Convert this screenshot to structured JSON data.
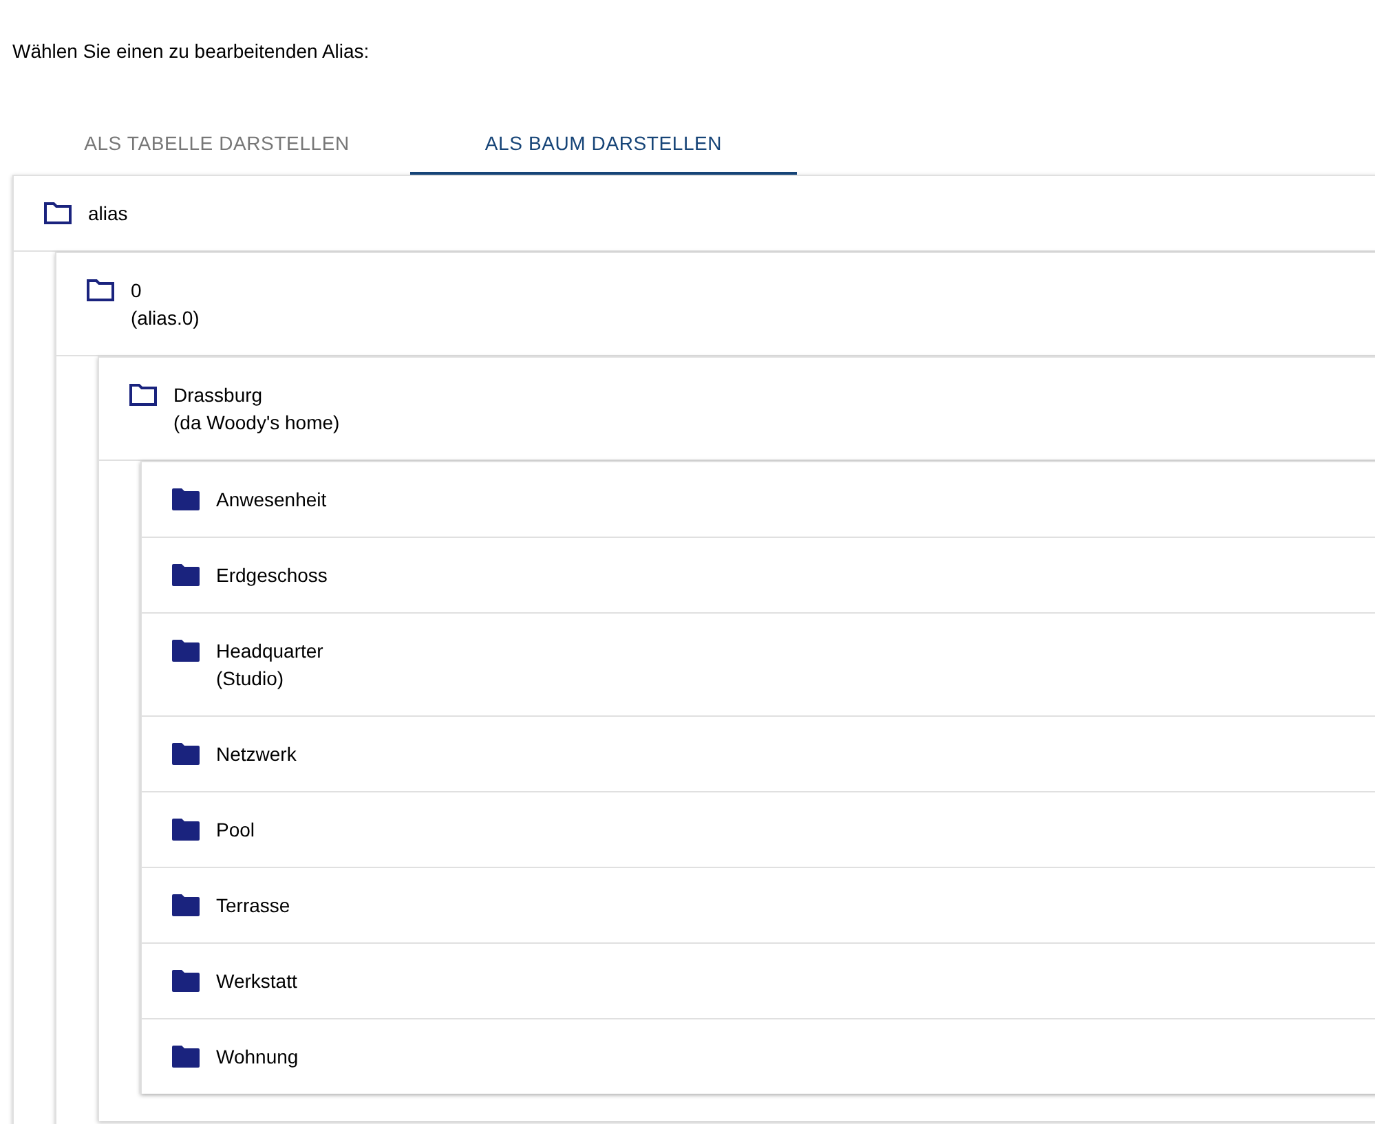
{
  "heading": "Wählen Sie einen zu bearbeitenden Alias:",
  "tabs": [
    {
      "label": "ALS TABELLE DARSTELLEN",
      "selected": false
    },
    {
      "label": "ALS BAUM DARSTELLEN",
      "selected": true
    }
  ],
  "tree": [
    {
      "name": "alias",
      "expanded": true,
      "children": [
        {
          "name": "0",
          "subtitle": "(alias.0)",
          "expanded": true,
          "children": [
            {
              "name": "Drassburg",
              "subtitle": "(da Woody's home)",
              "expanded": true,
              "children": [
                {
                  "name": "Anwesenheit",
                  "expanded": false
                },
                {
                  "name": "Erdgeschoss",
                  "expanded": false
                },
                {
                  "name": "Headquarter",
                  "subtitle": "(Studio)",
                  "expanded": false
                },
                {
                  "name": "Netzwerk",
                  "expanded": false
                },
                {
                  "name": "Pool",
                  "expanded": false
                },
                {
                  "name": "Terrasse",
                  "expanded": false
                },
                {
                  "name": "Werkstatt",
                  "expanded": false
                },
                {
                  "name": "Wohnung",
                  "expanded": false
                }
              ]
            }
          ]
        }
      ]
    }
  ]
}
